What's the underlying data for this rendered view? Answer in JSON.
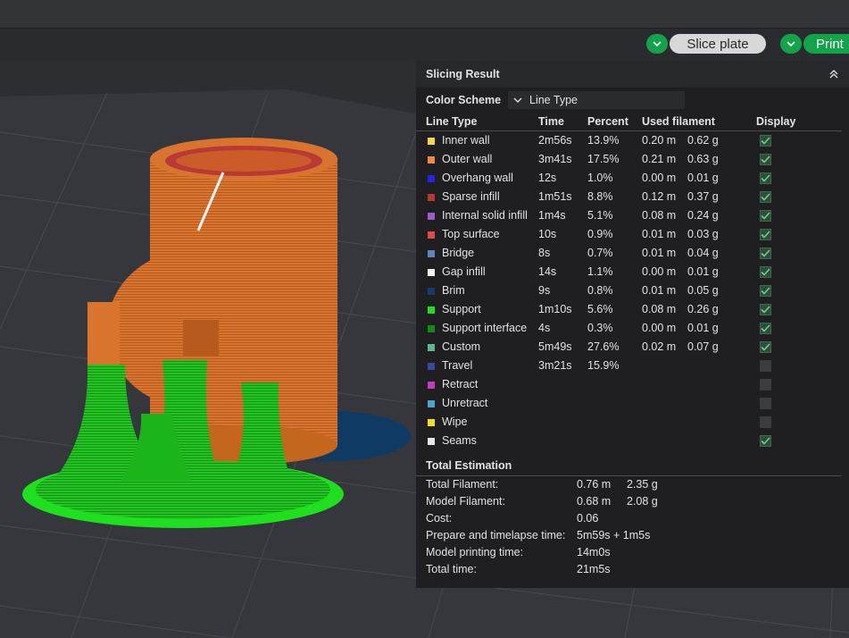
{
  "toolbar": {
    "slice_label": "Slice plate",
    "print_label": "Print"
  },
  "panel": {
    "title": "Slicing Result",
    "color_scheme_label": "Color Scheme",
    "color_scheme_value": "Line Type",
    "columns": {
      "line_type": "Line Type",
      "time": "Time",
      "percent": "Percent",
      "used_filament": "Used filament",
      "display": "Display"
    },
    "rows": [
      {
        "name": "Inner wall",
        "time": "2m56s",
        "percent": "13.9%",
        "len": "0.20 m",
        "weight": "0.62 g",
        "color": "#f5d74c",
        "display": true
      },
      {
        "name": "Outer wall",
        "time": "3m41s",
        "percent": "17.5%",
        "len": "0.21 m",
        "weight": "0.63 g",
        "color": "#ef8a3c",
        "display": true
      },
      {
        "name": "Overhang wall",
        "time": "12s",
        "percent": "1.0%",
        "len": "0.00 m",
        "weight": "0.01 g",
        "color": "#2424e6",
        "display": true
      },
      {
        "name": "Sparse infill",
        "time": "1m51s",
        "percent": "8.8%",
        "len": "0.12 m",
        "weight": "0.37 g",
        "color": "#b03a2e",
        "display": true
      },
      {
        "name": "Internal solid infill",
        "time": "1m4s",
        "percent": "5.1%",
        "len": "0.08 m",
        "weight": "0.24 g",
        "color": "#9a5cc6",
        "display": true
      },
      {
        "name": "Top surface",
        "time": "10s",
        "percent": "0.9%",
        "len": "0.01 m",
        "weight": "0.03 g",
        "color": "#e24a4a",
        "display": true
      },
      {
        "name": "Bridge",
        "time": "8s",
        "percent": "0.7%",
        "len": "0.01 m",
        "weight": "0.04 g",
        "color": "#5f86b8",
        "display": true
      },
      {
        "name": "Gap infill",
        "time": "14s",
        "percent": "1.1%",
        "len": "0.00 m",
        "weight": "0.01 g",
        "color": "#f2f2f2",
        "display": true
      },
      {
        "name": "Brim",
        "time": "9s",
        "percent": "0.8%",
        "len": "0.01 m",
        "weight": "0.05 g",
        "color": "#153b6a",
        "display": true
      },
      {
        "name": "Support",
        "time": "1m10s",
        "percent": "5.6%",
        "len": "0.08 m",
        "weight": "0.26 g",
        "color": "#1ee01e",
        "display": true
      },
      {
        "name": "Support interface",
        "time": "4s",
        "percent": "0.3%",
        "len": "0.00 m",
        "weight": "0.01 g",
        "color": "#108a10",
        "display": true
      },
      {
        "name": "Custom",
        "time": "5m49s",
        "percent": "27.6%",
        "len": "0.02 m",
        "weight": "0.07 g",
        "color": "#5ab88a",
        "display": true
      },
      {
        "name": "Travel",
        "time": "3m21s",
        "percent": "15.9%",
        "len": "",
        "weight": "",
        "color": "#3a4a9a",
        "display": false
      },
      {
        "name": "Retract",
        "time": "",
        "percent": "",
        "len": "",
        "weight": "",
        "color": "#c23ac2",
        "display": false
      },
      {
        "name": "Unretract",
        "time": "",
        "percent": "",
        "len": "",
        "weight": "",
        "color": "#4aa8c8",
        "display": false
      },
      {
        "name": "Wipe",
        "time": "",
        "percent": "",
        "len": "",
        "weight": "",
        "color": "#f2e01e",
        "display": false
      },
      {
        "name": "Seams",
        "time": "",
        "percent": "",
        "len": "",
        "weight": "",
        "color": "#e6e6e6",
        "display": true
      }
    ],
    "total_title": "Total Estimation",
    "totals": [
      {
        "label": "Total Filament:",
        "value": "0.76 m",
        "value2": "2.35 g"
      },
      {
        "label": "Model Filament:",
        "value": "0.68 m",
        "value2": "2.08 g"
      },
      {
        "label": "Cost:",
        "value": "0.06",
        "value2": ""
      },
      {
        "label": "Prepare and timelapse time:",
        "value": "5m59s + 1m5s",
        "value2": ""
      },
      {
        "label": "Model printing time:",
        "value": "14m0s",
        "value2": ""
      },
      {
        "label": "Total time:",
        "value": "21m5s",
        "value2": ""
      }
    ]
  }
}
